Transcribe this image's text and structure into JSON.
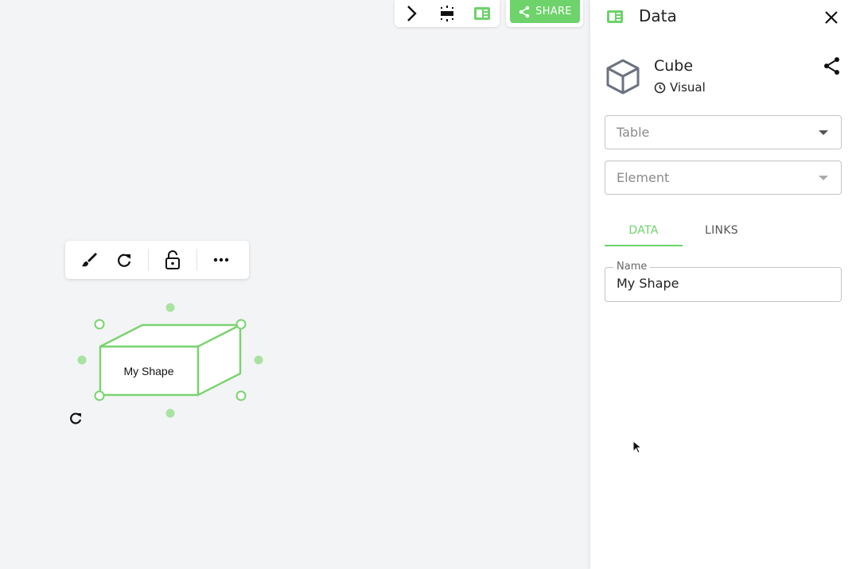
{
  "toolbar": {
    "share_label": "SHARE",
    "icons": [
      "chevron-right-icon",
      "fit-view-icon",
      "panel-layout-icon",
      "share-icon"
    ]
  },
  "shape_toolbar": {
    "icons": [
      "brush-icon",
      "redo-icon",
      "lock-open-icon",
      "more-icon"
    ]
  },
  "shape": {
    "label": "My Shape",
    "type": "cube"
  },
  "panel": {
    "title": "Data",
    "entity": {
      "name": "Cube",
      "subtitle": "Visual",
      "icon": "cube-icon"
    },
    "table_select": {
      "placeholder": "Table"
    },
    "element_select": {
      "placeholder": "Element"
    },
    "tabs": [
      {
        "label": "DATA",
        "active": true
      },
      {
        "label": "LINKS",
        "active": false
      }
    ],
    "name_field": {
      "label": "Name",
      "value": "My Shape"
    }
  },
  "colors": {
    "accent": "#6dd36a",
    "canvas": "#f3f4f6"
  }
}
